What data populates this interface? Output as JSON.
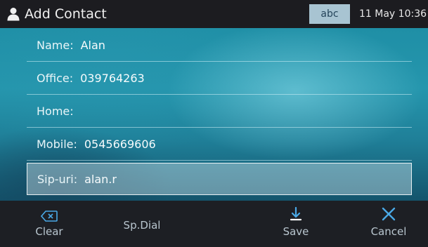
{
  "header": {
    "title": "Add Contact",
    "title_icon": "person-icon",
    "input_mode": "abc",
    "clock": "11 May 10:36"
  },
  "form": {
    "fields": [
      {
        "label": "Name:",
        "value": "Alan"
      },
      {
        "label": "Office:",
        "value": "039764263"
      },
      {
        "label": "Home:",
        "value": ""
      },
      {
        "label": "Mobile:",
        "value": "0545669606"
      },
      {
        "label": "Sip-uri:",
        "value": "alan.r",
        "selected": true
      }
    ]
  },
  "softkeys": [
    {
      "label": "Clear",
      "icon": "backspace-icon"
    },
    {
      "label": "Sp.Dial",
      "icon": ""
    },
    {
      "label": "Save",
      "icon": "save-arrow-icon"
    },
    {
      "label": "Cancel",
      "icon": "close-icon"
    }
  ],
  "colors": {
    "accent": "#4aa9e6",
    "titlebar": "#1c1c20",
    "softkey_bar": "#1d1f24",
    "badge": "#a8c4d2"
  }
}
